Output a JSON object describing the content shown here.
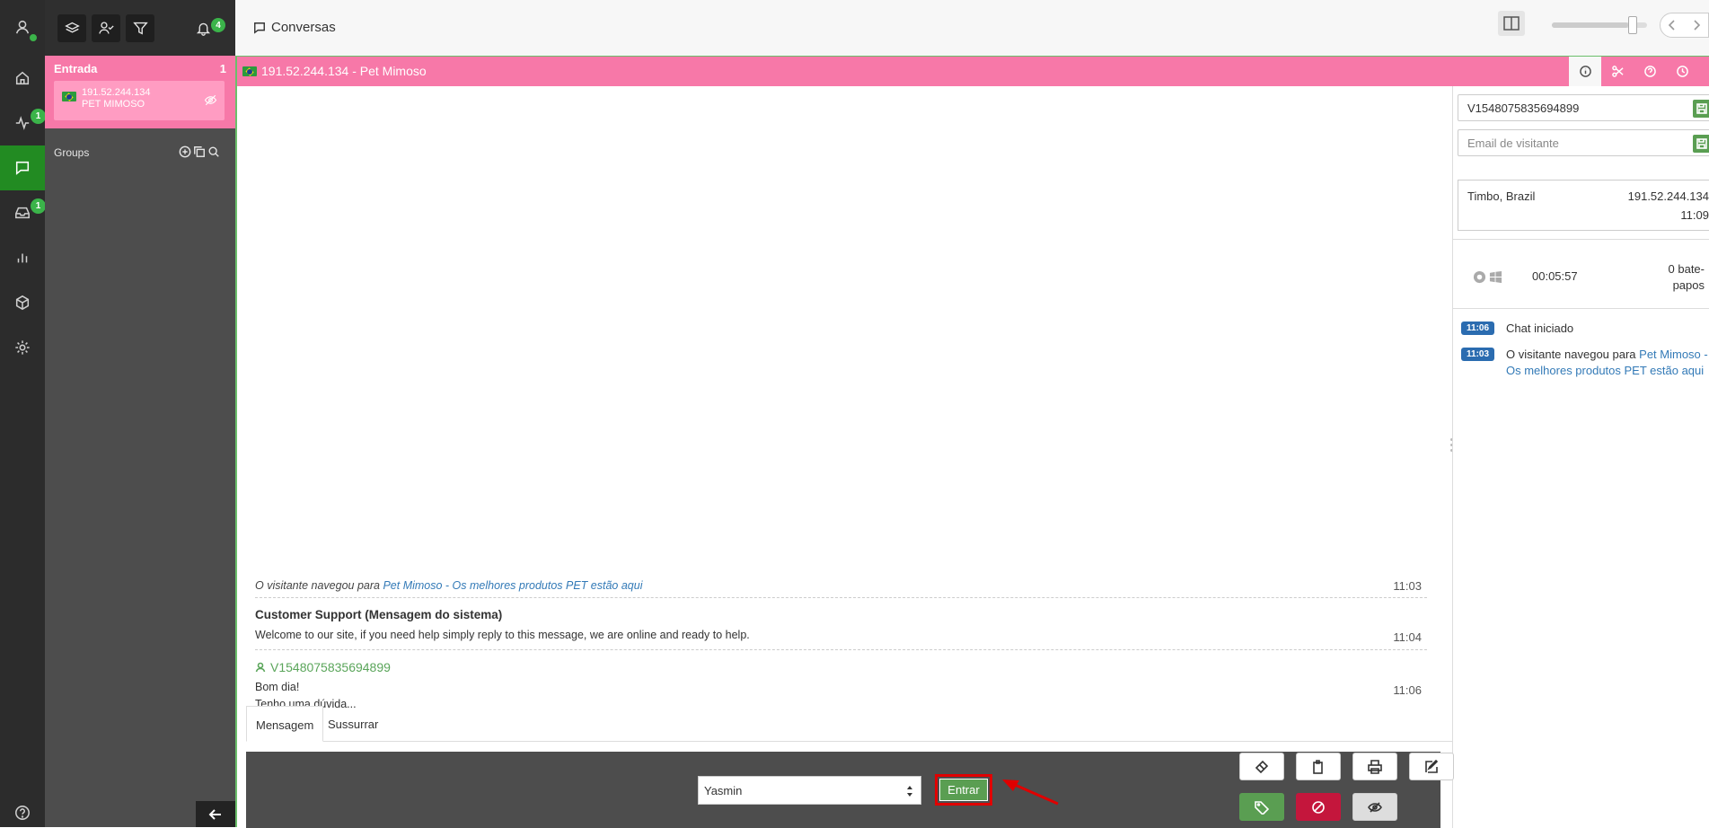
{
  "colors": {
    "accent_green": "#228b22",
    "pink": "#f778a8",
    "badge_green": "#3bb44a",
    "button_green": "#5a9e52",
    "danger_red": "#c4163c",
    "link_blue": "#337ab7"
  },
  "rail": {
    "items": [
      {
        "icon": "user-icon",
        "badge": ""
      },
      {
        "icon": "home-icon",
        "badge": ""
      },
      {
        "icon": "activity-icon",
        "badge": "1"
      },
      {
        "icon": "chat-icon",
        "badge": "",
        "active": true
      },
      {
        "icon": "inbox-icon",
        "badge": "1"
      },
      {
        "icon": "bar-chart-icon",
        "badge": ""
      },
      {
        "icon": "cube-icon",
        "badge": ""
      },
      {
        "icon": "gear-icon",
        "badge": ""
      },
      {
        "icon": "help-icon",
        "badge": ""
      }
    ]
  },
  "panel": {
    "tools": [
      "layers-icon",
      "user-check-icon",
      "filter-icon"
    ],
    "notifications_count": "4",
    "entrada": {
      "title": "Entrada",
      "count": "1"
    },
    "visitor": {
      "ip": "191.52.244.134",
      "name": "PET MIMOSO"
    },
    "groups_label": "Groups"
  },
  "header": {
    "title": "Conversas",
    "zoom_level": 0.8
  },
  "chat": {
    "title": "191.52.244.134 - Pet Mimoso",
    "head_tabs": [
      "info-icon",
      "scissors-icon",
      "question-icon",
      "clock-icon",
      "close-icon"
    ],
    "messages": {
      "nav": {
        "prefix": "O visitante navegou para ",
        "link": "Pet Mimoso - Os melhores produtos PET estão aqui",
        "time": "11:03"
      },
      "system": {
        "sender": "Customer Support (Mensagem do sistema)",
        "text": "Welcome to our site, if you need help simply reply to this message, we are online and ready to help.",
        "time": "11:04"
      },
      "visitor": {
        "sender": "V1548075835694899",
        "line1": "Bom dia!",
        "line2": "Tenho uma dúvida...",
        "time": "11:06"
      }
    },
    "tabs": [
      "Mensagem",
      "Sussurrar"
    ],
    "operator_select": "Yasmin",
    "entrar_label": "Entrar"
  },
  "info": {
    "visitor_id": "V1548075835694899",
    "email_placeholder": "Email de visitante",
    "city": "Timbo, Brazil",
    "ip": "191.52.244.134",
    "time": "11:09",
    "duration": "00:05:57",
    "chats_count": "0 bate-papos",
    "timeline": [
      {
        "time": "11:06",
        "text": "Chat iniciado"
      },
      {
        "time": "11:03",
        "prefix": "O visitante navegou para ",
        "link": "Pet Mimoso - Os melhores produtos PET estão aqui"
      }
    ]
  }
}
